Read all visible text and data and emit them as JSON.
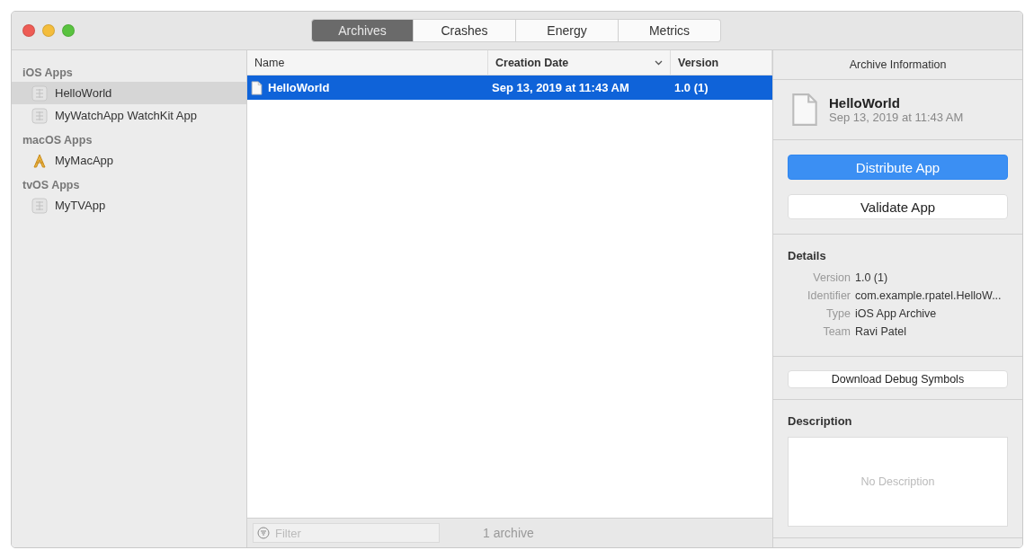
{
  "tabs": [
    {
      "label": "Archives",
      "selected": true
    },
    {
      "label": "Crashes",
      "selected": false
    },
    {
      "label": "Energy",
      "selected": false
    },
    {
      "label": "Metrics",
      "selected": false
    }
  ],
  "sidebar": {
    "groups": [
      {
        "title": "iOS Apps",
        "items": [
          {
            "label": "HelloWorld",
            "kind": "ios",
            "selected": true
          },
          {
            "label": "MyWatchApp WatchKit App",
            "kind": "watch",
            "selected": false
          }
        ]
      },
      {
        "title": "macOS Apps",
        "items": [
          {
            "label": "MyMacApp",
            "kind": "mac",
            "selected": false
          }
        ]
      },
      {
        "title": "tvOS Apps",
        "items": [
          {
            "label": "MyTVApp",
            "kind": "tv",
            "selected": false
          }
        ]
      }
    ]
  },
  "table": {
    "columns": [
      {
        "label": "Name",
        "sorted": false
      },
      {
        "label": "Creation Date",
        "sorted": true
      },
      {
        "label": "Version",
        "sorted": false
      }
    ],
    "rows": [
      {
        "cells": [
          "HelloWorld",
          "Sep 13, 2019 at 11:43 AM",
          "1.0 (1)"
        ],
        "selected": true
      }
    ]
  },
  "footer": {
    "filter_placeholder": "Filter",
    "count": "1 archive"
  },
  "inspector": {
    "header": "Archive Information",
    "archive_name": "HelloWorld",
    "archive_date": "Sep 13, 2019 at 11:43 AM",
    "primary_button": "Distribute App",
    "secondary_button": "Validate App",
    "details_title": "Details",
    "details": [
      {
        "label": "Version",
        "value": "1.0 (1)"
      },
      {
        "label": "Identifier",
        "value": "com.example.rpatel.HelloW..."
      },
      {
        "label": "Type",
        "value": "iOS App Archive"
      },
      {
        "label": "Team",
        "value": "Ravi Patel"
      }
    ],
    "debug_button": "Download Debug Symbols",
    "description_title": "Description",
    "description_placeholder": "No Description"
  }
}
